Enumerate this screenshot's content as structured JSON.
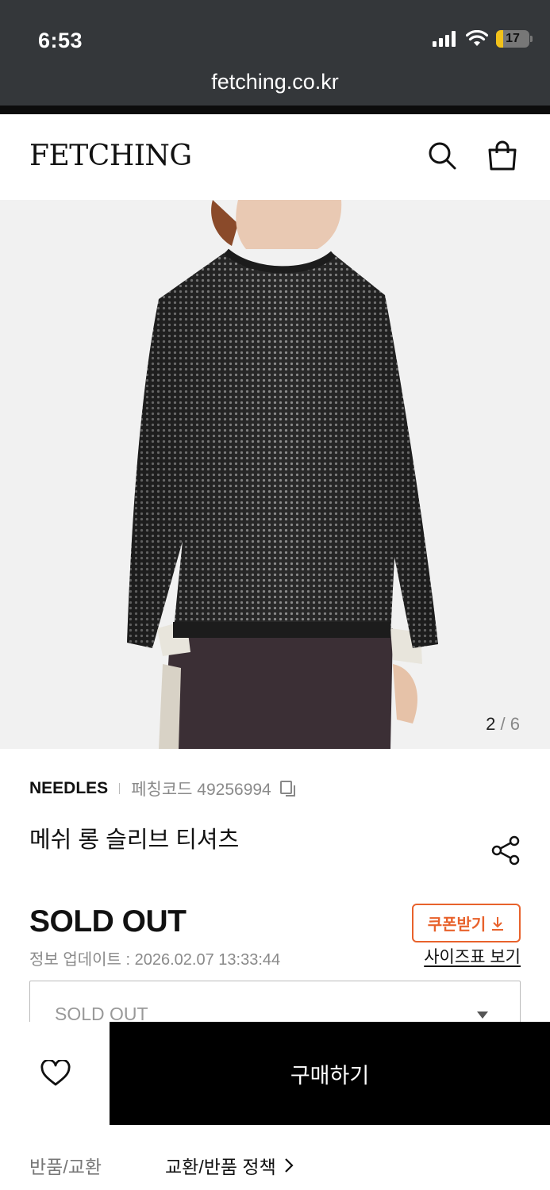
{
  "status_bar": {
    "time": "6:53",
    "battery": "17"
  },
  "browser": {
    "url": "fetching.co.kr"
  },
  "header": {
    "logo": "FETCHING"
  },
  "gallery": {
    "current": "2",
    "separator": " / ",
    "total": "6"
  },
  "product": {
    "brand": "NEEDLES",
    "code_label": "페칭코드 49256994",
    "name": "메쉬 롱 슬리브 티셔츠",
    "price": "SOLD OUT",
    "updated": "정보 업데이트 : 2026.02.07 13:33:44",
    "coupon_label": "쿠폰받기",
    "size_chart_link": "사이즈표 보기",
    "option_select_value": "SOLD OUT"
  },
  "purchase_bar": {
    "buy_label": "구매하기"
  },
  "policy": {
    "label": "반품/교환",
    "link": "교환/반품 정책"
  },
  "colors": {
    "chrome": "#34373a",
    "accent_coupon": "#e8622c",
    "buy_button": "#000000"
  }
}
